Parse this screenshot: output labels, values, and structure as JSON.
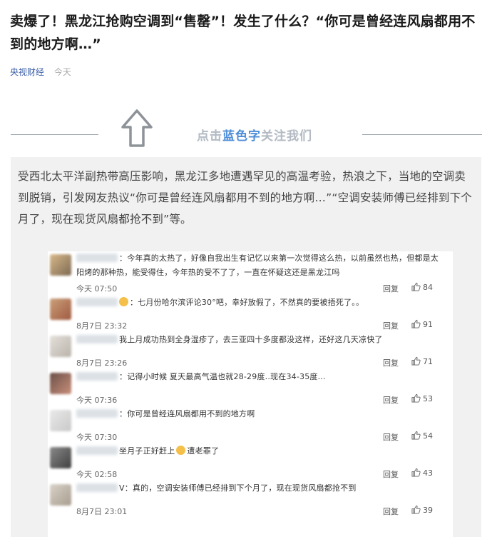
{
  "article": {
    "headline": "卖爆了！黑龙江抢购空调到“售罄”！发生了什么？“你可是曾经连风扇都用不到的地方啊…”",
    "source": "央视财经",
    "time": "今天"
  },
  "follow_banner": {
    "prefix": "点击",
    "highlight": "蓝色字",
    "suffix": "关注我们",
    "highlight_color": "#4f8fd9"
  },
  "intro": "受西北太平洋副热带高压影响，黑龙江多地遭遇罕见的高温考验，热浪之下，当地的空调卖到脱销，引发网友热议“你可是曾经连风扇都用不到的地方啊…”“空调安装师傅已经排到下个月了，现在现货风扇都抢不到”等。",
  "comments": [
    {
      "text": "：今年真的太热了，好像自我出生有记忆以来第一次觉得这么热，以前虽然也热，但都是太阳烤的那种热，能受得住，今年热的受不了了，一直在怀疑这还是黑龙江吗",
      "time": "今天 07:50",
      "reply": "回复",
      "likes": "84"
    },
    {
      "text": "：七月份哈尔滨评论30°吧，幸好放假了，不然真的要被捂死了。。",
      "time": "8月7日 23:32",
      "reply": "回复",
      "likes": "91"
    },
    {
      "text": "我上月成功热到全身湿疹了，去三亚四十多度都没这样，还好这几天凉快了",
      "time": "8月7日 23:26",
      "reply": "回复",
      "likes": "71"
    },
    {
      "text": "：记得小时候 夏天最高气温也就28-29度..现在34-35度...",
      "time": "今天 07:36",
      "reply": "回复",
      "likes": "53"
    },
    {
      "text": "：你可是曾经连风扇都用不到的地方啊",
      "time": "今天 07:30",
      "reply": "回复",
      "likes": "54"
    },
    {
      "text": "坐月子正好赶上",
      "text2": "遭老罪了",
      "time": "今天 02:58",
      "reply": "回复",
      "likes": "43"
    },
    {
      "text": "V：真的，空调安装师傅已经排到下个月了，现在现货风扇都抢不到",
      "time": "8月7日 23:01",
      "reply": "回复",
      "likes": "39"
    }
  ]
}
